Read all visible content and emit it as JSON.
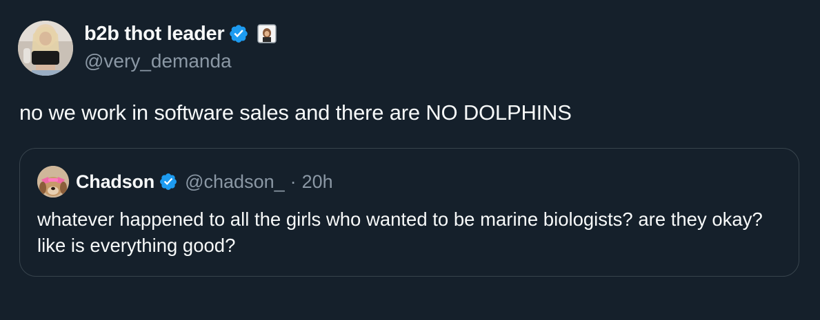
{
  "tweet": {
    "author": {
      "display_name": "b2b thot leader",
      "handle": "@very_demanda",
      "verified": true,
      "avatar_icon": "profile-photo",
      "badge_icon": "affiliate-badge"
    },
    "text": "no we work in software sales and there are NO DOLPHINS",
    "quoted": {
      "author": {
        "display_name": "Chadson",
        "handle": "@chadson_",
        "verified": true,
        "avatar_icon": "dog-profile-photo"
      },
      "separator": "·",
      "time": "20h",
      "text": "whatever happened to all the girls who wanted to be marine biologists? are they okay? like is everything good?"
    }
  },
  "colors": {
    "background": "#15202b",
    "text_primary": "#f7f9f9",
    "text_secondary": "#8b98a5",
    "verified_blue": "#1d9bf0",
    "border": "#38444d"
  }
}
